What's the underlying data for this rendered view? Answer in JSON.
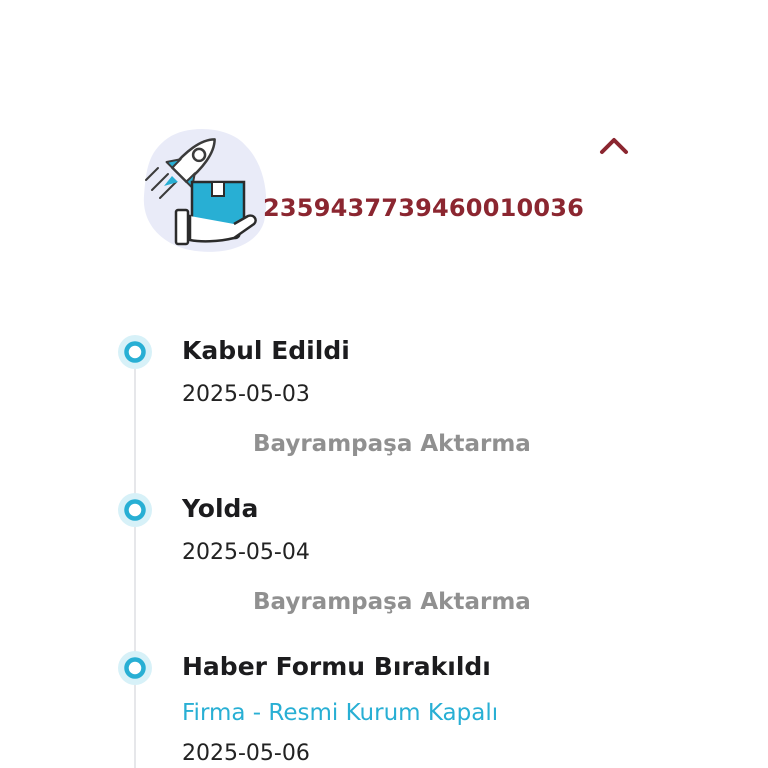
{
  "shipment": {
    "tracking_number": "2359437739460010036",
    "illustration_icon": "rocket-delivery-icon",
    "toggle_icon": "chevron-up-icon"
  },
  "colors": {
    "brand": "#8b2630",
    "accent": "#28afd4",
    "muted": "#909090"
  },
  "timeline": {
    "events": [
      {
        "title": "Kabul Edildi",
        "date": "2025-05-03",
        "location": "Bayrampaşa Aktarma"
      },
      {
        "title": "Yolda",
        "date": "2025-05-04",
        "location": "Bayrampaşa Aktarma"
      },
      {
        "title": "Haber Formu Bırakıldı",
        "note": "Firma - Resmi Kurum Kapalı",
        "date": "2025-05-06"
      }
    ]
  }
}
